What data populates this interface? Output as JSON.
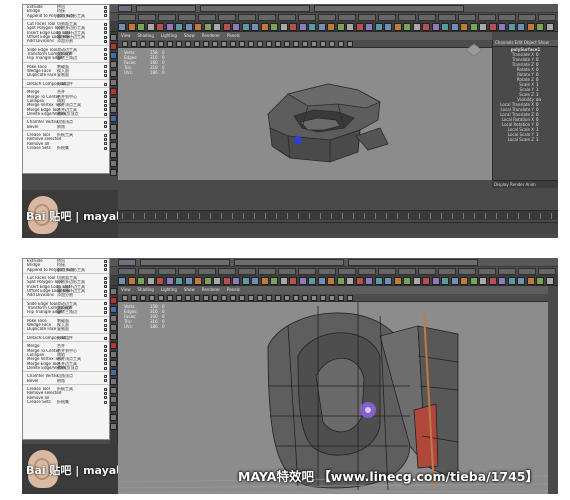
{
  "watermark": {
    "site": "Bai 贴吧 | maya吧"
  },
  "banner": "MAYA特效吧 【www.linecg.com/tieba/1745】",
  "menu_top": [
    {
      "en": "Extrude",
      "cn": "挤出"
    },
    {
      "en": "Bridge",
      "cn": "桥接"
    },
    {
      "en": "Append to Polygon Tool",
      "cn": "附加多边形工具"
    },
    {
      "sep": true
    },
    {
      "en": "Cut Faces Tool",
      "cn": "切割面工具"
    },
    {
      "en": "Split Polygon Tool",
      "cn": "分割多边形工具"
    },
    {
      "en": "Insert Edge Loop Tool",
      "cn": "插入循环边工具"
    },
    {
      "en": "Offset Edge Loop Tool",
      "cn": "偏移循环边工具"
    },
    {
      "en": "Add Divisions",
      "cn": "添加分割"
    },
    {
      "sep": true
    },
    {
      "en": "Slide Edge Tool",
      "cn": "滑动边工具"
    },
    {
      "en": "Transform Component",
      "cn": "变换组件"
    },
    {
      "en": "Flip Triangle Edge",
      "cn": "翻转三角边"
    },
    {
      "sep": true
    },
    {
      "en": "Poke Face",
      "cn": "刺破面"
    },
    {
      "en": "Wedge Face",
      "cn": "楔入面"
    },
    {
      "en": "Duplicate Face",
      "cn": "复制面"
    },
    {
      "sep": true
    },
    {
      "en": "Detach Component",
      "cn": "分离组件"
    },
    {
      "sep": true
    },
    {
      "en": "Merge",
      "cn": "合并"
    },
    {
      "en": "Merge To Center",
      "cn": "合并到中心"
    },
    {
      "en": "Collapse",
      "cn": "塌陷"
    },
    {
      "en": "Merge Vertex Tool",
      "cn": "合并顶点工具"
    },
    {
      "en": "Merge Edge Tool",
      "cn": "合并边工具"
    },
    {
      "en": "Delete Edge/Vertex",
      "cn": "删除边/顶点"
    },
    {
      "sep": true
    },
    {
      "en": "Chamfer Vertex",
      "cn": "切角顶点"
    },
    {
      "en": "Bevel",
      "cn": "倒角"
    },
    {
      "sep": true
    },
    {
      "en": "Crease Tool",
      "cn": "折痕工具"
    },
    {
      "en": "Remove selected",
      "cn": ""
    },
    {
      "en": "Remove all",
      "cn": ""
    },
    {
      "en": "Crease Sets",
      "cn": "折痕集"
    }
  ],
  "menu_bottom": [
    {
      "en": "Extrude",
      "cn": "挤出"
    },
    {
      "en": "Bridge",
      "cn": "桥接"
    },
    {
      "en": "Append to Polygon Tool",
      "cn": "附加多边形工具"
    },
    {
      "sep": true
    },
    {
      "en": "Cut Faces Tool",
      "cn": "切割面工具"
    },
    {
      "en": "Split Polygon Tool",
      "cn": "分割多边形工具"
    },
    {
      "en": "Insert Edge Loop Tool",
      "cn": "插入循环边工具"
    },
    {
      "en": "Offset Edge Loop Tool",
      "cn": "偏移循环边工具"
    },
    {
      "en": "Add Divisions",
      "cn": "添加分割"
    },
    {
      "sep": true
    },
    {
      "en": "Slide Edge Tool",
      "cn": "滑动边工具"
    },
    {
      "en": "Transform Component",
      "cn": "变换组件"
    },
    {
      "en": "Flip Triangle Edge",
      "cn": "翻转三角边"
    },
    {
      "sep": true
    },
    {
      "en": "Poke Face",
      "cn": "刺破面"
    },
    {
      "en": "Wedge Face",
      "cn": "楔入面"
    },
    {
      "en": "Duplicate Face",
      "cn": "复制面"
    },
    {
      "sep": true
    },
    {
      "en": "Detach Component",
      "cn": "分离组件"
    },
    {
      "sep": true
    },
    {
      "en": "Merge",
      "cn": "合并"
    },
    {
      "en": "Merge To Center",
      "cn": "合并到中心"
    },
    {
      "en": "Collapse",
      "cn": "塌陷"
    },
    {
      "en": "Merge Vertex Tool",
      "cn": "合并顶点工具"
    },
    {
      "en": "Merge Edge Tool",
      "cn": "合并边工具"
    },
    {
      "en": "Delete Edge/Vertex",
      "cn": "删除边/顶点"
    },
    {
      "sep": true
    },
    {
      "en": "Chamfer Vertex",
      "cn": "切角顶点"
    },
    {
      "en": "Bevel",
      "cn": "倒角"
    },
    {
      "sep": true
    },
    {
      "en": "Crease Tool",
      "cn": "折痕工具"
    },
    {
      "en": "Remove selected",
      "cn": ""
    },
    {
      "en": "Remove all",
      "cn": ""
    },
    {
      "en": "Crease Sets",
      "cn": "折痕集"
    }
  ],
  "viewport_menu": [
    "View",
    "Shading",
    "Lighting",
    "Show",
    "Renderer",
    "Panels"
  ],
  "hud": [
    {
      "label": "Verts:",
      "a": "158",
      "b": "0"
    },
    {
      "label": "Edges:",
      "a": "316",
      "b": "0"
    },
    {
      "label": "Faces:",
      "a": "160",
      "b": "0"
    },
    {
      "label": "Tris:",
      "a": "316",
      "b": "0"
    },
    {
      "label": "UVs:",
      "a": "186",
      "b": "0"
    }
  ],
  "channel_box": {
    "tabs": "Channels Edit Object Show",
    "title": "polySurface1",
    "rows": [
      {
        "k": "Translate X",
        "v": "0"
      },
      {
        "k": "Translate Y",
        "v": "0"
      },
      {
        "k": "Translate Z",
        "v": "0"
      },
      {
        "k": "Rotate X",
        "v": "0"
      },
      {
        "k": "Rotate Y",
        "v": "0"
      },
      {
        "k": "Rotate Z",
        "v": "0"
      },
      {
        "k": "Scale X",
        "v": "1"
      },
      {
        "k": "Scale Y",
        "v": "1"
      },
      {
        "k": "Scale Z",
        "v": "1"
      },
      {
        "k": "Visibility",
        "v": "on"
      },
      {
        "k": "Local Translate X",
        "v": "0"
      },
      {
        "k": "Local Translate Y",
        "v": "0"
      },
      {
        "k": "Local Translate Z",
        "v": "0"
      },
      {
        "k": "Local Rotation X",
        "v": "0"
      },
      {
        "k": "Local Rotation Y",
        "v": "0"
      },
      {
        "k": "Local Scale X",
        "v": "1"
      },
      {
        "k": "Local Scale Y",
        "v": "1"
      },
      {
        "k": "Local Scale Z",
        "v": "1"
      }
    ],
    "layers": "Display Render Anim"
  }
}
